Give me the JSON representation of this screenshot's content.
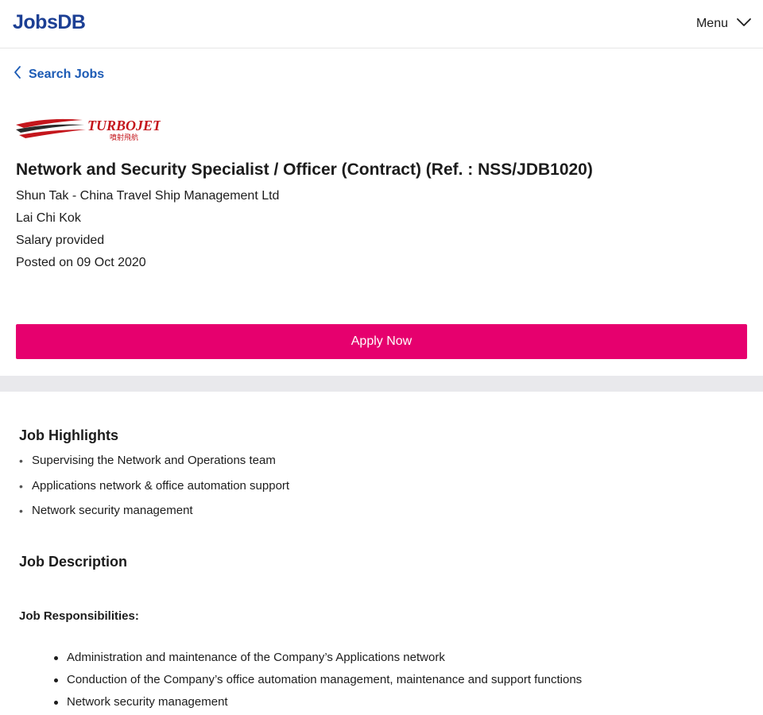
{
  "header": {
    "logo_text": "JobsDB",
    "menu_label": "Menu",
    "menu_icon": "chevron-down-icon",
    "brand_color": "#1c3f94"
  },
  "nav": {
    "back_label": "Search Jobs",
    "back_icon": "chevron-left-icon",
    "link_color": "#1c5bb5"
  },
  "job": {
    "company_logo_text": "TURBOJET",
    "company_logo_chinese": "噴射飛航",
    "title": "Network and Security Specialist / Officer (Contract) (Ref. : NSS/JDB1020)",
    "company": "Shun Tak - China Travel Ship Management Ltd",
    "location": "Lai Chi Kok",
    "salary": "Salary provided",
    "posted": "Posted on 09 Oct 2020"
  },
  "apply": {
    "label": "Apply Now",
    "color": "#e6006e"
  },
  "highlights": {
    "title": "Job Highlights",
    "items": [
      "Supervising the Network and Operations team",
      "Applications network & office automation support",
      "Network security management"
    ]
  },
  "description": {
    "title": "Job Description",
    "responsibilities_heading": "Job Responsibilities:",
    "responsibilities": [
      "Administration and maintenance of the Company’s Applications network",
      "Conduction of the Company’s office automation management, maintenance and support functions",
      "Network security management"
    ]
  }
}
